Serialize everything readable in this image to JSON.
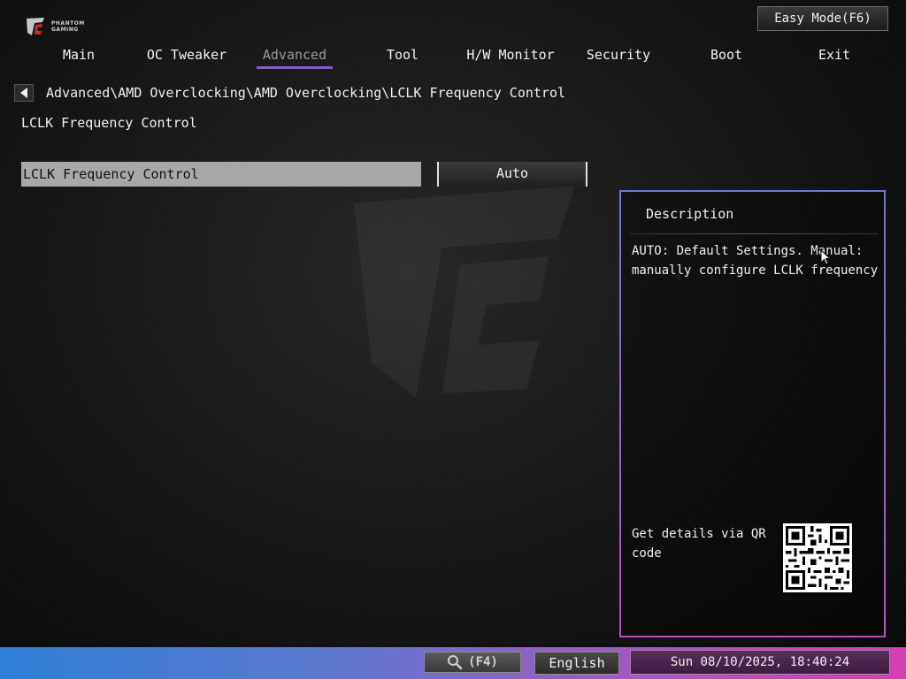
{
  "brand": {
    "logo_text": "PHANTOM\nGAMING"
  },
  "header": {
    "easy_mode_label": "Easy Mode(F6)"
  },
  "nav": {
    "tabs": [
      {
        "label": "Main"
      },
      {
        "label": "OC Tweaker"
      },
      {
        "label": "Advanced",
        "active": true
      },
      {
        "label": "Tool"
      },
      {
        "label": "H/W Monitor"
      },
      {
        "label": "Security"
      },
      {
        "label": "Boot"
      },
      {
        "label": "Exit"
      }
    ]
  },
  "breadcrumb": "Advanced\\AMD Overclocking\\AMD Overclocking\\LCLK Frequency Control",
  "page": {
    "section_title": "LCLK Frequency Control",
    "setting": {
      "label": "LCLK Frequency Control",
      "value": "Auto"
    }
  },
  "description": {
    "title": "Description",
    "text": "AUTO: Default Settings. Manual: manually configure LCLK frequency",
    "qr_label": "Get details via QR code"
  },
  "footer": {
    "search_label": "(F4)",
    "language": "English",
    "datetime": "Sun 08/10/2025, 18:40:24"
  },
  "colors": {
    "accent_purple": "#8a5cc9",
    "bar_left": "#2f7fd6",
    "bar_right": "#d43fb0"
  }
}
